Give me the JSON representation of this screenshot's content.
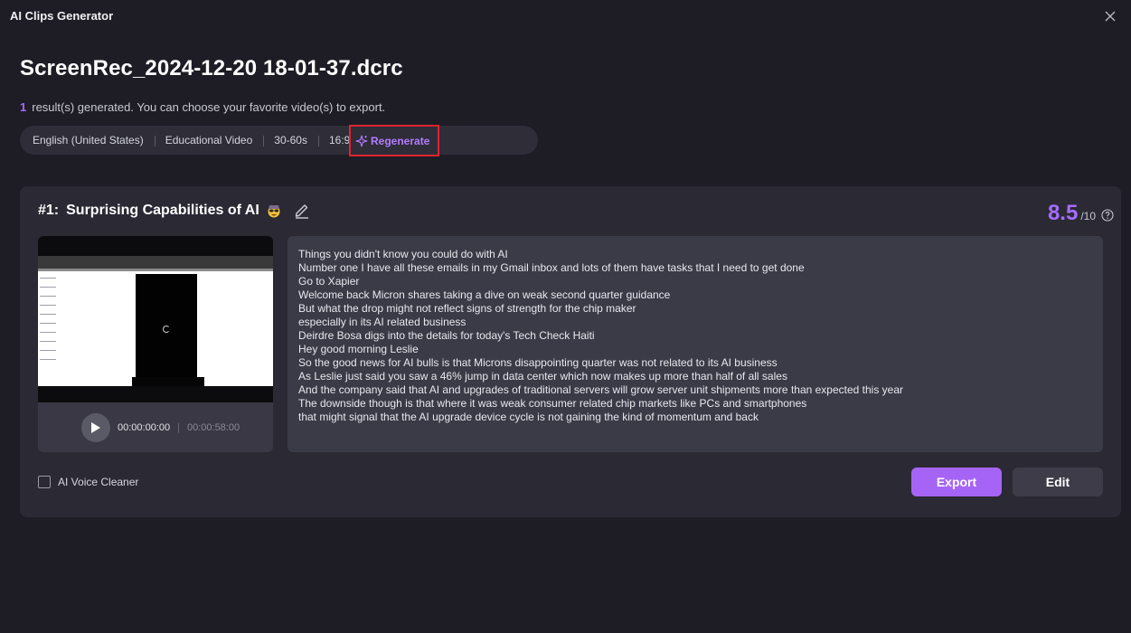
{
  "window": {
    "title": "AI Clips Generator",
    "close_icon": "close-icon"
  },
  "file": {
    "name": "ScreenRec_2024-12-20 18-01-37.dcrc"
  },
  "results": {
    "count": "1",
    "message": "result(s) generated. You can choose your favorite video(s) to export."
  },
  "options": {
    "language": "English (United States)",
    "category": "Educational Video",
    "duration": "30-60s",
    "aspect_ratio": "16:9",
    "regenerate_label": "Regenerate",
    "regenerate_icon": "sparkle-icon"
  },
  "clip": {
    "number": "#1:",
    "title": "Surprising Capabilities of AI",
    "title_icon": "mind-blown-emoji-icon",
    "edit_icon": "pencil-icon",
    "score": "8.5",
    "score_max": "/10",
    "help_icon": "question-circle-icon",
    "current_time": "00:00:00:00",
    "separator": "|",
    "total_time": "00:00:58:00",
    "transcript": [
      "Things you didn't know you could do with AI",
      "Number one I have all these emails in my Gmail inbox and lots of them have tasks that I need to get done",
      "Go to Xapier",
      "Welcome back Micron shares taking a dive on weak second quarter guidance",
      "But what the drop might not reflect signs of strength for the chip maker",
      "especially in its AI related business",
      "Deirdre Bosa digs into the details for today's Tech Check Haiti",
      "Hey good morning Leslie",
      "So the good news for AI bulls is that Microns disappointing quarter was not related to its AI business",
      "As Leslie just said you saw a 46% jump in data center which now makes up more than half of all sales",
      "And the company said that AI and upgrades of traditional servers will grow server unit shipments more than expected this year",
      "The downside though is that where it was weak consumer related chip markets like PCs and smartphones",
      "that might signal that the AI upgrade device cycle is not gaining the kind of momentum and back"
    ]
  },
  "footer": {
    "voice_cleaner_label": "AI Voice Cleaner",
    "voice_cleaner_checked": false,
    "export_label": "Export",
    "edit_label": "Edit"
  },
  "colors": {
    "background": "#1e1d26",
    "card": "#2a2934",
    "accent": "#a66cff",
    "highlight_border": "#e0242e"
  }
}
